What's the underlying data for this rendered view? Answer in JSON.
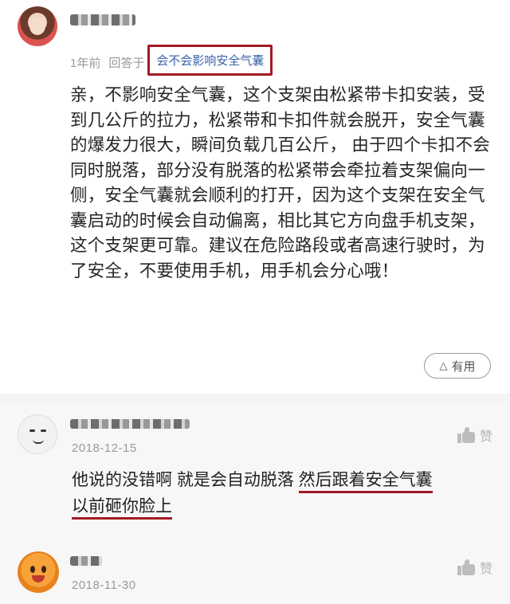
{
  "answer": {
    "time_ago": "1年前",
    "reply_prefix": "回答于",
    "question": "会不会影响安全气囊",
    "body": "亲，不影响安全气囊，这个支架由松紧带卡扣安装，受到几公斤的拉力，松紧带和卡扣件就会脱开，安全气囊的爆发力很大，瞬间负载几百公斤， 由于四个卡扣不会同时脱落，部分没有脱落的松紧带会牵拉着支架偏向一侧，安全气囊就会顺利的打开，因为这个支架在安全气囊启动的时候会自动偏离，相比其它方向盘手机支架，这个支架更可靠。建议在危险路段或者高速行驶时，为了安全，不要使用手机，用手机会分心哦！",
    "useful_label": "有用",
    "useful_icon": "triangle-up-icon"
  },
  "comments": [
    {
      "date": "2018-12-15",
      "like_label": "赞",
      "text_plain": "他说的没错啊 就是会自动脱落 ",
      "text_underlined_1": "然后跟着安全气囊",
      "text_underlined_2": "以前砸你脸上"
    },
    {
      "date": "2018-11-30",
      "like_label": "赞"
    }
  ],
  "colors": {
    "highlight_border": "#a11a24",
    "link": "#3a62a8",
    "meta_gray": "#9a9a9a",
    "comment_bg": "#f7f7f7"
  }
}
